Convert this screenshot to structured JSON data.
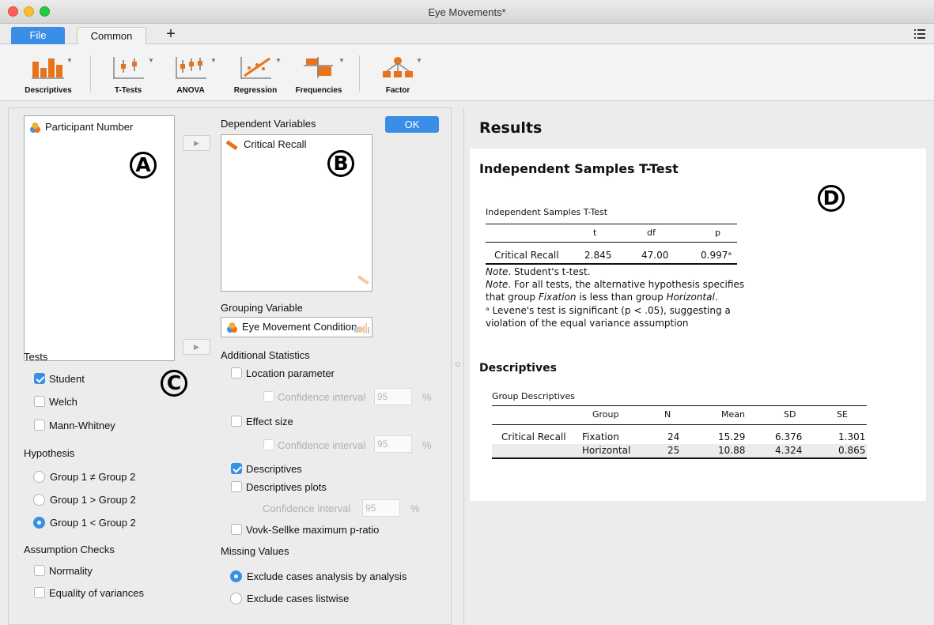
{
  "window": {
    "title": "Eye Movements*"
  },
  "tabs": {
    "file": "File",
    "common": "Common",
    "add": "+"
  },
  "ribbon": {
    "descriptives": "Descriptives",
    "ttests": "T-Tests",
    "anova": "ANOVA",
    "regression": "Regression",
    "frequencies": "Frequencies",
    "factor": "Factor"
  },
  "source": {
    "items": [
      "Participant Number"
    ]
  },
  "dependent": {
    "header": "Dependent Variables",
    "items": [
      "Critical Recall"
    ]
  },
  "ok_label": "OK",
  "grouping": {
    "header": "Grouping Variable",
    "value": "Eye Movement Condition"
  },
  "annotations": {
    "a": "A",
    "b": "B",
    "c": "C",
    "d": "D"
  },
  "tests": {
    "header": "Tests",
    "student": "Student",
    "welch": "Welch",
    "mann_whitney": "Mann-Whitney"
  },
  "hypothesis": {
    "header": "Hypothesis",
    "ne": "Group 1 ≠ Group 2",
    "gt": "Group 1 > Group 2",
    "lt": "Group 1 < Group 2"
  },
  "assumptions": {
    "header": "Assumption Checks",
    "normality": "Normality",
    "equality": "Equality of variances"
  },
  "additional": {
    "header": "Additional Statistics",
    "location": "Location parameter",
    "ci": "Confidence interval",
    "ci_value": "95",
    "pct": "%",
    "effect_size": "Effect size",
    "descriptives": "Descriptives",
    "descriptives_plots": "Descriptives plots",
    "vovk": "Vovk-Sellke maximum p-ratio"
  },
  "missing": {
    "header": "Missing Values",
    "analysis": "Exclude cases analysis by analysis",
    "listwise": "Exclude cases listwise"
  },
  "results": {
    "title": "Results",
    "ttest_heading": "Independent Samples T-Test",
    "ttest_caption": "Independent Samples T-Test",
    "ttest_cols": [
      "t",
      "df",
      "p"
    ],
    "ttest_row": {
      "label": "Critical Recall",
      "t": "2.845",
      "df": "47.00",
      "p": "0.997ᵃ"
    },
    "note1_label": "Note",
    "note1_text": ". Student's t-test.",
    "note2_label": "Note",
    "note2_text_a": ". For all tests, the alternative hypothesis specifies",
    "note2_text_b1": "that group ",
    "note2_fix": "Fixation",
    "note2_text_b2": " is less than group ",
    "note2_hor": "Horizontal",
    "note2_text_b3": ".",
    "note3_a": "ᵃ Levene's test is significant (p < .05), suggesting a",
    "note3_b": "violation of the equal variance assumption",
    "desc_heading": "Descriptives",
    "desc_caption": "Group Descriptives",
    "desc_cols": [
      "Group",
      "N",
      "Mean",
      "SD",
      "SE"
    ],
    "desc_rows": [
      {
        "label": "Critical Recall",
        "group": "Fixation",
        "n": "24",
        "mean": "15.29",
        "sd": "6.376",
        "se": "1.301"
      },
      {
        "label": "",
        "group": "Horizontal",
        "n": "25",
        "mean": "10.88",
        "sd": "4.324",
        "se": "0.865"
      }
    ]
  },
  "colors": {
    "accent": "#3b8ee6",
    "file_tab": "#3b8ee6"
  }
}
